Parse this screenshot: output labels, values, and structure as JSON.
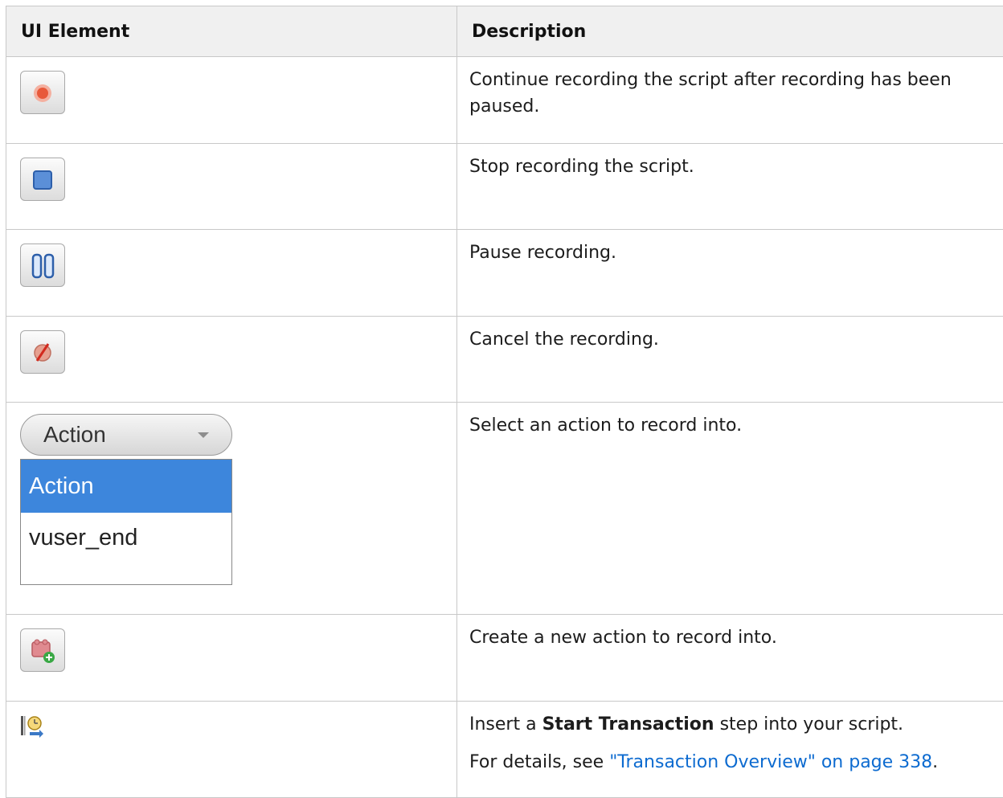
{
  "table": {
    "headers": {
      "ui_element": "UI Element",
      "description": "Description"
    },
    "rows": [
      {
        "icon": "resume-record-icon",
        "description": "Continue recording the script after recording has been paused."
      },
      {
        "icon": "stop-record-icon",
        "description": "Stop recording the script."
      },
      {
        "icon": "pause-record-icon",
        "description": "Pause recording."
      },
      {
        "icon": "cancel-record-icon",
        "description": "Cancel the recording."
      },
      {
        "icon": "action-dropdown",
        "description": "Select an action to record into."
      },
      {
        "icon": "new-action-icon",
        "description": "Create a new action to record into."
      },
      {
        "icon": "start-transaction-icon",
        "description_prefix": "Insert a ",
        "description_bold": "Start Transaction",
        "description_suffix": " step into your script.",
        "details_prefix": "For details, see ",
        "details_link": "\"Transaction Overview\" on page 338",
        "details_suffix": "."
      }
    ]
  },
  "action_dropdown": {
    "selected_value": "Action",
    "options": [
      "Action",
      "vuser_end"
    ]
  },
  "colors": {
    "link": "#0d6bd0",
    "selected_option": "#3d86dc",
    "header_bg": "#f0f0f0"
  }
}
